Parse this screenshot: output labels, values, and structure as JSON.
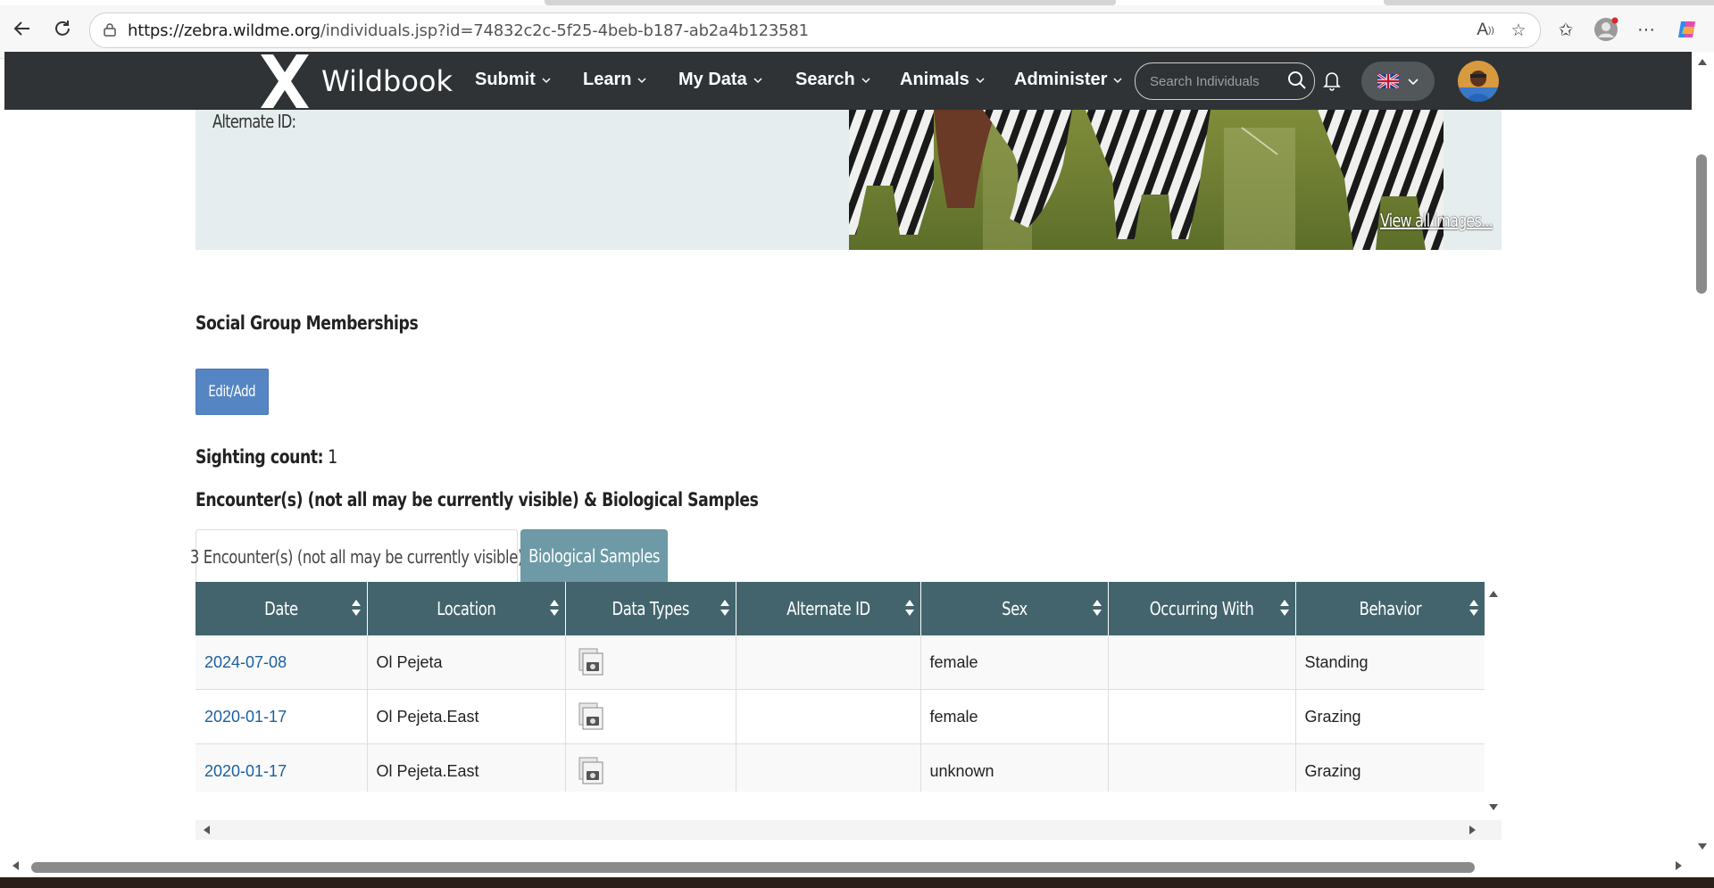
{
  "browser": {
    "url_host": "https://zebra.wildme.org",
    "url_path": "/individuals.jsp?id=74832c2c-5f25-4beb-b187-ab2a4b123581",
    "icons": [
      "back-icon",
      "refresh-icon",
      "lock-icon",
      "read-aloud-icon",
      "favorite-star-icon",
      "favorites-list-icon",
      "profile-icon",
      "more-icon",
      "copilot-icon"
    ]
  },
  "nav": {
    "brand": "Wildbook",
    "menu": [
      "Submit",
      "Learn",
      "My Data",
      "Search",
      "Animals",
      "Administer"
    ],
    "search_placeholder": "Search Individuals"
  },
  "individual": {
    "alternate_id_label": "Alternate ID:",
    "view_all_images": "View all images..."
  },
  "social": {
    "heading": "Social Group Memberships",
    "edit_button": "Edit/Add"
  },
  "sighting": {
    "label": "Sighting count:",
    "value": "1"
  },
  "encounters": {
    "heading": "Encounter(s) (not all may be currently visible) & Biological Samples",
    "tabs": [
      "3 Encounter(s) (not all may be currently visible)",
      "Biological Samples"
    ],
    "columns": [
      "Date",
      "Location",
      "Data Types",
      "Alternate ID",
      "Sex",
      "Occurring With",
      "Behavior"
    ],
    "rows": [
      {
        "date": "2024-07-08",
        "location": "Ol Pejeta",
        "alternate_id": "",
        "sex": "female",
        "occurring_with": "",
        "behavior": "Standing"
      },
      {
        "date": "2020-01-17",
        "location": "Ol Pejeta.East",
        "alternate_id": "",
        "sex": "female",
        "occurring_with": "",
        "behavior": "Grazing"
      },
      {
        "date": "2020-01-17",
        "location": "Ol Pejeta.East",
        "alternate_id": "",
        "sex": "unknown",
        "occurring_with": "",
        "behavior": "Grazing"
      }
    ]
  },
  "colors": {
    "nav_bg": "#2f3335",
    "table_header": "#43646d",
    "active_tab": "#6d9aa6",
    "button": "#5585c2",
    "link": "#1b5f9e"
  }
}
